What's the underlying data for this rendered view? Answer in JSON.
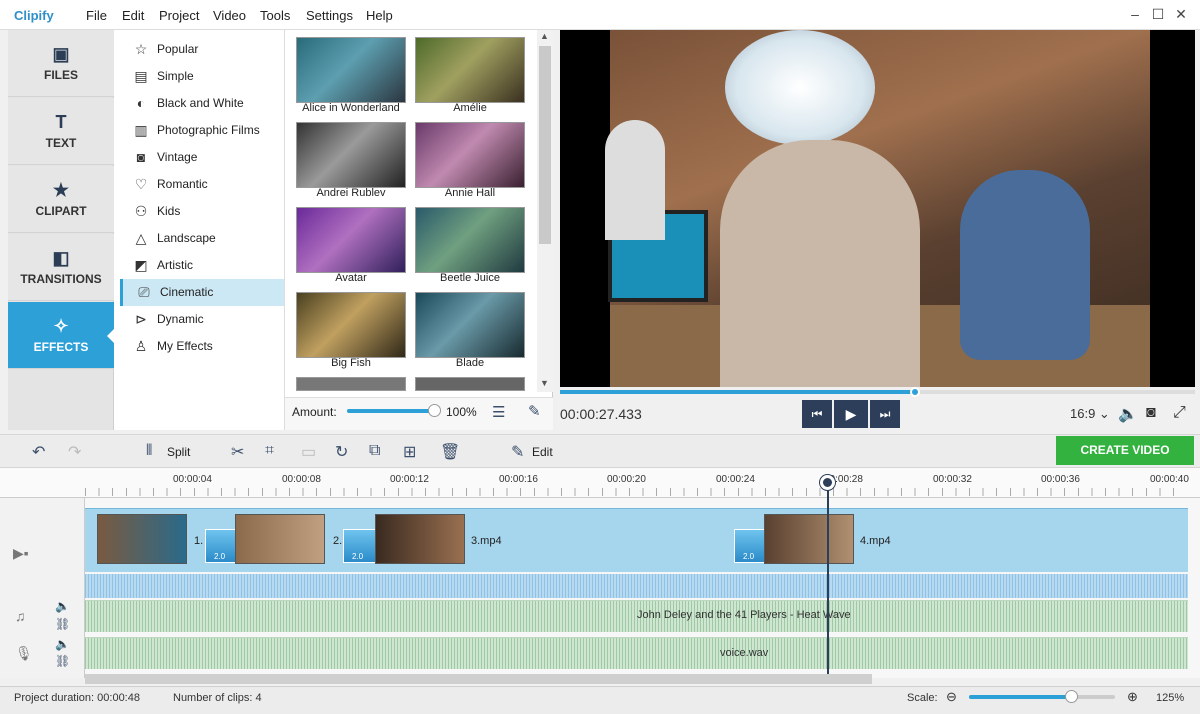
{
  "app": {
    "name": "Clipify",
    "menu": [
      "File",
      "Edit",
      "Project",
      "Video",
      "Tools",
      "Settings",
      "Help"
    ]
  },
  "nav": {
    "tabs": [
      {
        "label": "FILES",
        "icon": "image-icon"
      },
      {
        "label": "TEXT",
        "icon": "text-icon"
      },
      {
        "label": "CLIPART",
        "icon": "star-icon"
      },
      {
        "label": "TRANSITIONS",
        "icon": "transitions-icon"
      },
      {
        "label": "EFFECTS",
        "icon": "effects-icon",
        "active": true
      }
    ]
  },
  "categories": [
    {
      "label": "Popular",
      "icon": "star-outline-icon"
    },
    {
      "label": "Simple",
      "icon": "list-icon"
    },
    {
      "label": "Black and White",
      "icon": "contrast-icon"
    },
    {
      "label": "Photographic Films",
      "icon": "film-icon"
    },
    {
      "label": "Vintage",
      "icon": "camera-icon"
    },
    {
      "label": "Romantic",
      "icon": "heart-icon"
    },
    {
      "label": "Kids",
      "icon": "kids-icon"
    },
    {
      "label": "Landscape",
      "icon": "mountain-icon"
    },
    {
      "label": "Artistic",
      "icon": "palette-icon"
    },
    {
      "label": "Cinematic",
      "icon": "cinema-icon",
      "active": true
    },
    {
      "label": "Dynamic",
      "icon": "dynamic-icon"
    },
    {
      "label": "My Effects",
      "icon": "user-icon"
    }
  ],
  "effects": [
    {
      "label": "Alice in Wonderland"
    },
    {
      "label": "Amélie"
    },
    {
      "label": "Andrei Rublev"
    },
    {
      "label": "Annie Hall"
    },
    {
      "label": "Avatar"
    },
    {
      "label": "Beetle Juice"
    },
    {
      "label": "Big Fish"
    },
    {
      "label": "Blade"
    }
  ],
  "amount": {
    "label": "Amount:",
    "value": "100%"
  },
  "preview": {
    "time": "00:00:27.433",
    "aspect": "16:9 ⌄",
    "progress": 0.56
  },
  "toolbar": {
    "split": "Split",
    "edit": "Edit",
    "create_video": "CREATE VIDEO"
  },
  "timeline": {
    "ticks": [
      "00:00:04",
      "00:00:08",
      "00:00:12",
      "00:00:16",
      "00:00:20",
      "00:00:24",
      "00:00:28",
      "00:00:32",
      "00:00:36",
      "00:00:40"
    ],
    "clips": [
      "1.",
      "2.",
      "3.mp4",
      "4.mp4"
    ],
    "transition_duration": "2.0",
    "music": "John Deley and the 41 Players - Heat Wave",
    "voice": "voice.wav"
  },
  "status": {
    "duration": "Project duration:  00:00:48",
    "clips": "Number of clips: 4",
    "scale_label": "Scale:",
    "scale_value": "125%",
    "scale_level": 0.7
  },
  "colors": {
    "accent": "#2ea0d8",
    "create_button": "#33b23f",
    "playhead": "#2c3e5a"
  }
}
